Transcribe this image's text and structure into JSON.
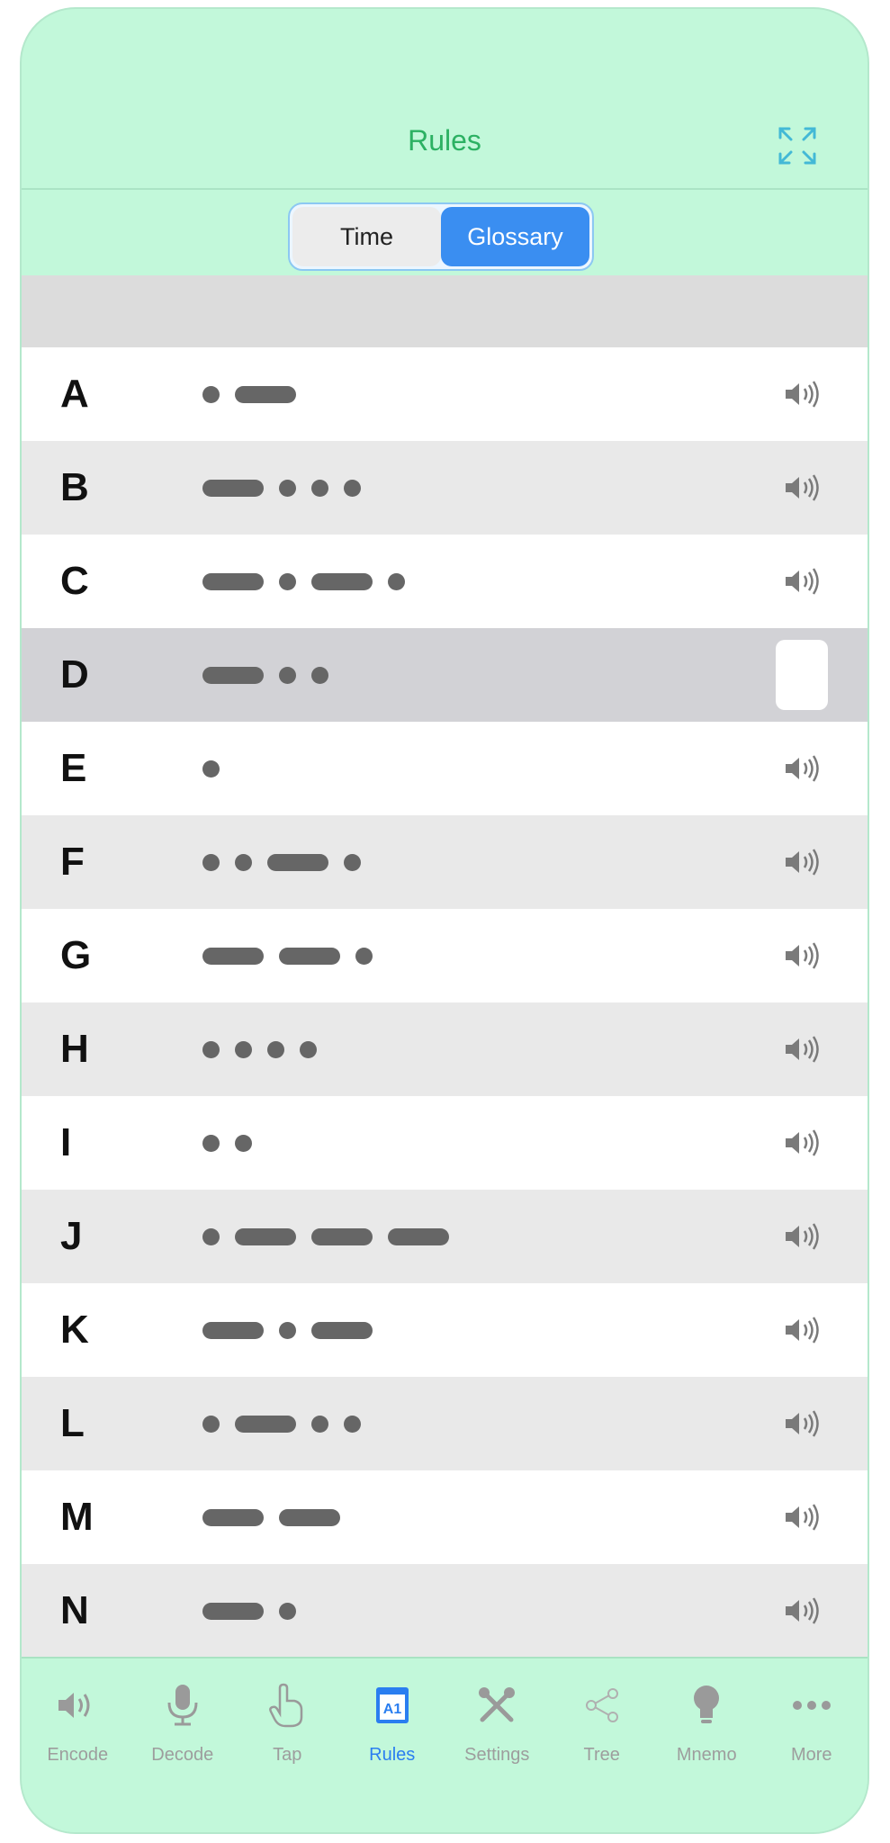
{
  "header": {
    "title": "Rules"
  },
  "segmented": {
    "options": [
      "Time",
      "Glossary"
    ],
    "selected": "Glossary"
  },
  "rows": [
    {
      "letter": "A",
      "code": ".-"
    },
    {
      "letter": "B",
      "code": "-..."
    },
    {
      "letter": "C",
      "code": "-.-."
    },
    {
      "letter": "D",
      "code": "-..",
      "selected": true
    },
    {
      "letter": "E",
      "code": "."
    },
    {
      "letter": "F",
      "code": "..-."
    },
    {
      "letter": "G",
      "code": "--."
    },
    {
      "letter": "H",
      "code": "...."
    },
    {
      "letter": "I",
      "code": ".."
    },
    {
      "letter": "J",
      "code": ".---"
    },
    {
      "letter": "K",
      "code": "-.-"
    },
    {
      "letter": "L",
      "code": ".-.."
    },
    {
      "letter": "M",
      "code": "--"
    },
    {
      "letter": "N",
      "code": "-."
    }
  ],
  "tabs": [
    {
      "label": "Encode",
      "icon": "speaker-icon"
    },
    {
      "label": "Decode",
      "icon": "microphone-icon"
    },
    {
      "label": "Tap",
      "icon": "hand-pointer-icon"
    },
    {
      "label": "Rules",
      "icon": "rules-a1-icon",
      "active": true
    },
    {
      "label": "Settings",
      "icon": "tools-icon"
    },
    {
      "label": "Tree",
      "icon": "share-tree-icon"
    },
    {
      "label": "Mnemo",
      "icon": "lightbulb-icon"
    },
    {
      "label": "More",
      "icon": "more-dots-icon"
    }
  ],
  "colors": {
    "background": "#c2f8da",
    "accent": "#2a7ef0",
    "title": "#2cb163",
    "symbol": "#666666"
  }
}
